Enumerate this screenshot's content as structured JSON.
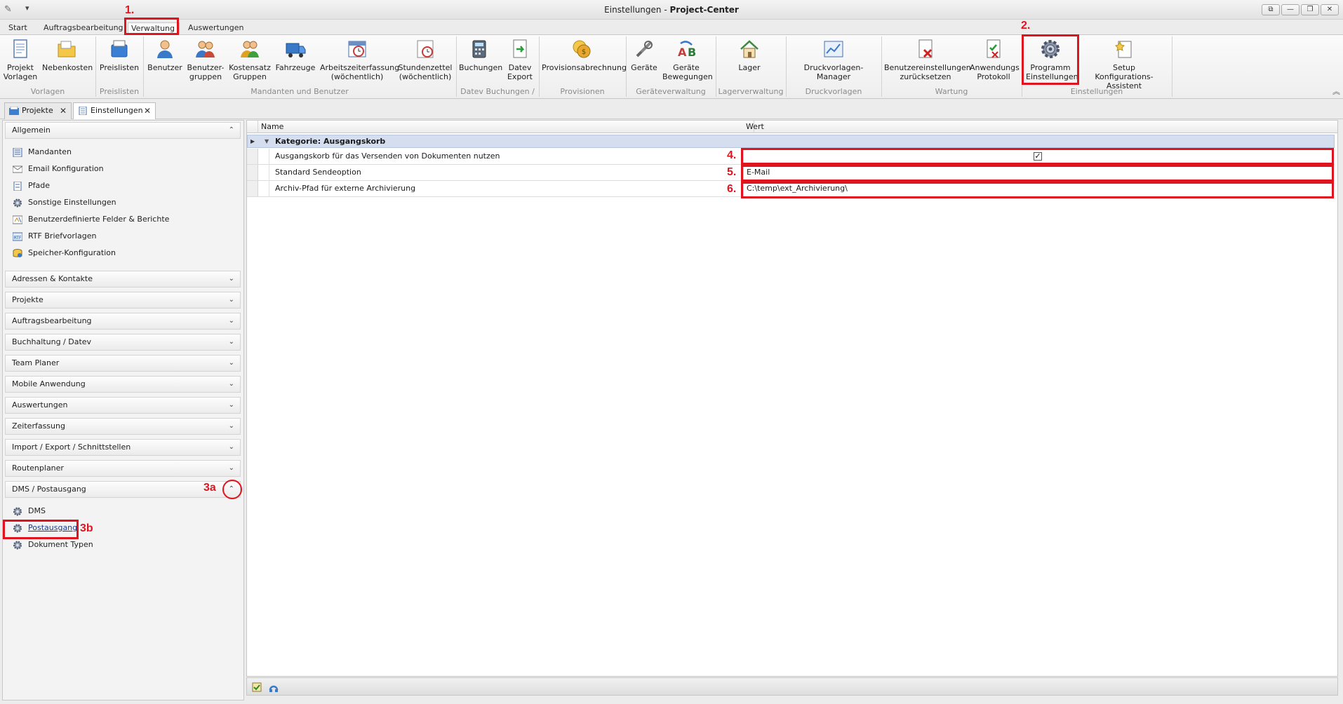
{
  "window": {
    "title_prefix": "Einstellungen - ",
    "title_app": "Project-Center",
    "quick_access": "▾",
    "btn_restore_left": "⧉",
    "btn_minimize": "—",
    "btn_restore": "❐",
    "btn_close": "✕"
  },
  "ribbon_tabs": [
    "Start",
    "Auftragsbearbeitung",
    "Verwaltung",
    "Auswertungen"
  ],
  "ribbon": {
    "buttons": {
      "projekt_vorlagen": [
        "Projekt",
        "Vorlagen"
      ],
      "nebenkosten": [
        "Nebenkosten",
        ""
      ],
      "preislisten": [
        "Preislisten",
        ""
      ],
      "benutzer": [
        "Benutzer",
        ""
      ],
      "benutzer_gruppen": [
        "Benutzer-",
        "gruppen"
      ],
      "kostensatz_gruppen": [
        "Kostensatz",
        "Gruppen"
      ],
      "fahrzeuge": [
        "Fahrzeuge",
        ""
      ],
      "arbeitszeiterfassung": [
        "Arbeitszeiterfassung",
        "(wöchentlich)"
      ],
      "stundenzettel": [
        "Stundenzettel",
        "(wöchentlich)"
      ],
      "buchungen": [
        "Buchungen",
        ""
      ],
      "datev_export": [
        "Datev",
        "Export"
      ],
      "provisionsabrechnung": [
        "Provisionsabrechnung",
        ""
      ],
      "geraete": [
        "Geräte",
        ""
      ],
      "geraete_bewegungen": [
        "Geräte",
        "Bewegungen"
      ],
      "lager": [
        "Lager",
        ""
      ],
      "druckvorlagen_manager": [
        "Druckvorlagen-Manager",
        ""
      ],
      "benutzereinstellungen_zuruecksetzen": [
        "Benutzereinstellungen",
        "zurücksetzen"
      ],
      "anwendungs_protokoll": [
        "Anwendungs",
        "Protokoll"
      ],
      "programm_einstellungen": [
        "Programm",
        "Einstellungen"
      ],
      "setup_assistent": [
        "Setup",
        "Konfigurations-Assistent"
      ]
    },
    "groups": {
      "vorlagen": "Vorlagen",
      "preislisten": "Preislisten",
      "mandanten_benutzer": "Mandanten und Benutzer",
      "datev": "Datev Buchungen / ...",
      "provisionen": "Provisionen",
      "geraeteverwaltung": "Geräteverwaltung",
      "lagerverwaltung": "Lagerverwaltung",
      "druckvorlagen": "Druckvorlagen",
      "wartung": "Wartung",
      "einstellungen": "Einstellungen"
    },
    "collapse": "︽"
  },
  "doc_tabs": [
    {
      "label": "Projekte",
      "close": "✕"
    },
    {
      "label": "Einstellungen",
      "close": "✕"
    }
  ],
  "sidebar": {
    "allgemein": {
      "title": "Allgemein",
      "items": [
        "Mandanten",
        "Email Konfiguration",
        "Pfade",
        "Sonstige Einstellungen",
        "Benutzerdefinierte Felder & Berichte",
        "RTF Briefvorlagen",
        "Speicher-Konfiguration"
      ]
    },
    "groups": [
      "Adressen & Kontakte",
      "Projekte",
      "Auftragsbearbeitung",
      "Buchhaltung / Datev",
      "Team Planer",
      "Mobile Anwendung",
      "Auswertungen",
      "Zeiterfassung",
      "Import / Export / Schnittstellen",
      "Routenplaner"
    ],
    "dms": {
      "title": "DMS / Postausgang",
      "items": [
        "DMS",
        "Postausgang",
        "Dokument Typen"
      ]
    },
    "chev_down": "⌄",
    "chev_up": "⌃"
  },
  "grid": {
    "col_name": "Name",
    "col_value": "Wert",
    "category": "Kategorie: Ausgangskorb",
    "rows": [
      {
        "name": "Ausgangskorb für das Versenden von Dokumenten nutzen",
        "value": "",
        "checked": "✓"
      },
      {
        "name": "Standard Sendeoption",
        "value": "E-Mail"
      },
      {
        "name": "Archiv-Pfad für externe Archivierung",
        "value": "C:\\temp\\ext_Archivierung\\"
      }
    ],
    "arrow_row": "▶",
    "arrow_cat": "▼"
  },
  "annotations": {
    "l1": "1.",
    "l2": "2.",
    "l3a": "3a",
    "l3b": "3b",
    "l4": "4.",
    "l5": "5.",
    "l6": "6."
  },
  "colors": {
    "annotation_red": "#e0141e",
    "category_bg": "#d5deee"
  }
}
